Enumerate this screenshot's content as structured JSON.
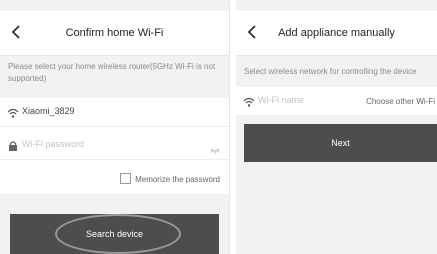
{
  "screen_left": {
    "title": "Confirm home Wi-Fi",
    "hint": "Please select your home wireless router(5GHz Wi-Fi is not supported)",
    "ssid": "Xiaomi_3829",
    "password_placeholder": "Wi-Fi password",
    "memorize_label": "Memorize the password",
    "primary_button": "Search device"
  },
  "screen_right": {
    "title": "Add appliance manually",
    "hint": "Select wireless network for controlling the device",
    "wifi_placeholder": "Wi-Fi name",
    "choose_other": "Choose other Wi-Fi",
    "primary_button": "Next"
  },
  "icons": {
    "back": "chevron-left-icon",
    "wifi": "wifi-icon",
    "lock": "lock-icon",
    "eye": "eye-off-icon",
    "checkbox": "checkbox-unchecked"
  },
  "colors": {
    "button_bg": "#4d4d4d",
    "button_text": "#ffffff",
    "annotation_ellipse": "#9a9a9a"
  }
}
